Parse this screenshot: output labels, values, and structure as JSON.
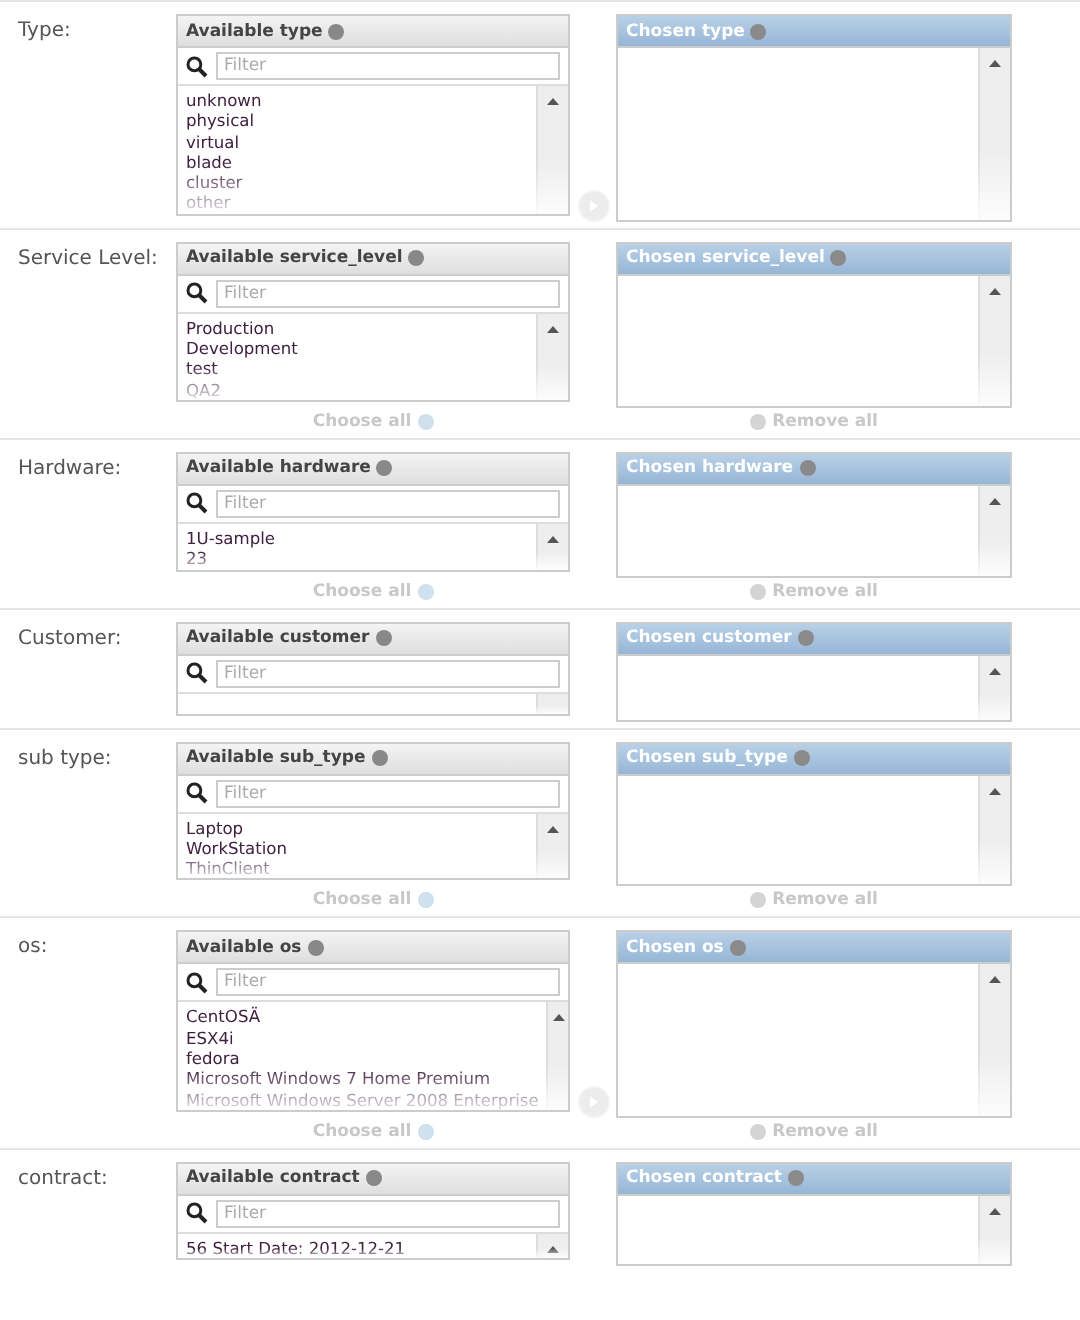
{
  "fields": [
    {
      "label": "Type:",
      "available": "Available type",
      "filter_placeholder": "Filter",
      "options": [
        "unknown",
        "physical",
        "virtual",
        "blade",
        "cluster",
        "other"
      ],
      "chosen": "Chosen type",
      "move_arrow": true
    },
    {
      "label": "Service Level:",
      "available": "Available service_level",
      "filter_placeholder": "Filter",
      "options": [
        "Production",
        "Development",
        "test",
        "QA2"
      ],
      "chosen": "Chosen service_level",
      "choose_all": "Choose all",
      "remove_all": "Remove all"
    },
    {
      "label": "Hardware:",
      "available": "Available hardware",
      "filter_placeholder": "Filter",
      "options": [
        "1U-sample",
        "23"
      ],
      "chosen": "Chosen hardware",
      "choose_all": "Choose all",
      "remove_all": "Remove all"
    },
    {
      "label": "Customer:",
      "available": "Available customer",
      "filter_placeholder": "Filter",
      "chosen": "Chosen customer"
    },
    {
      "label": "sub type:",
      "available": "Available sub_type",
      "filter_placeholder": "Filter",
      "options": [
        "Laptop",
        "WorkStation",
        "ThinClient"
      ],
      "chosen": "Chosen sub_type",
      "choose_all": "Choose all",
      "remove_all": "Remove all"
    },
    {
      "label": "os:",
      "available": "Available os",
      "filter_placeholder": "Filter",
      "options": [
        "CentOSÄ",
        "ESX4i",
        "fedora",
        "Microsoft Windows 7 Home Premium",
        "Microsoft Windows Server 2008 Enterprise"
      ],
      "chosen": "Chosen os",
      "move_arrow": true,
      "choose_all": "Choose all",
      "remove_all": "Remove all"
    },
    {
      "label": "contract:",
      "available": "Available contract",
      "filter_placeholder": "Filter",
      "options": [
        "56 Start Date: 2012-12-21"
      ],
      "chosen": "Chosen contract"
    }
  ]
}
